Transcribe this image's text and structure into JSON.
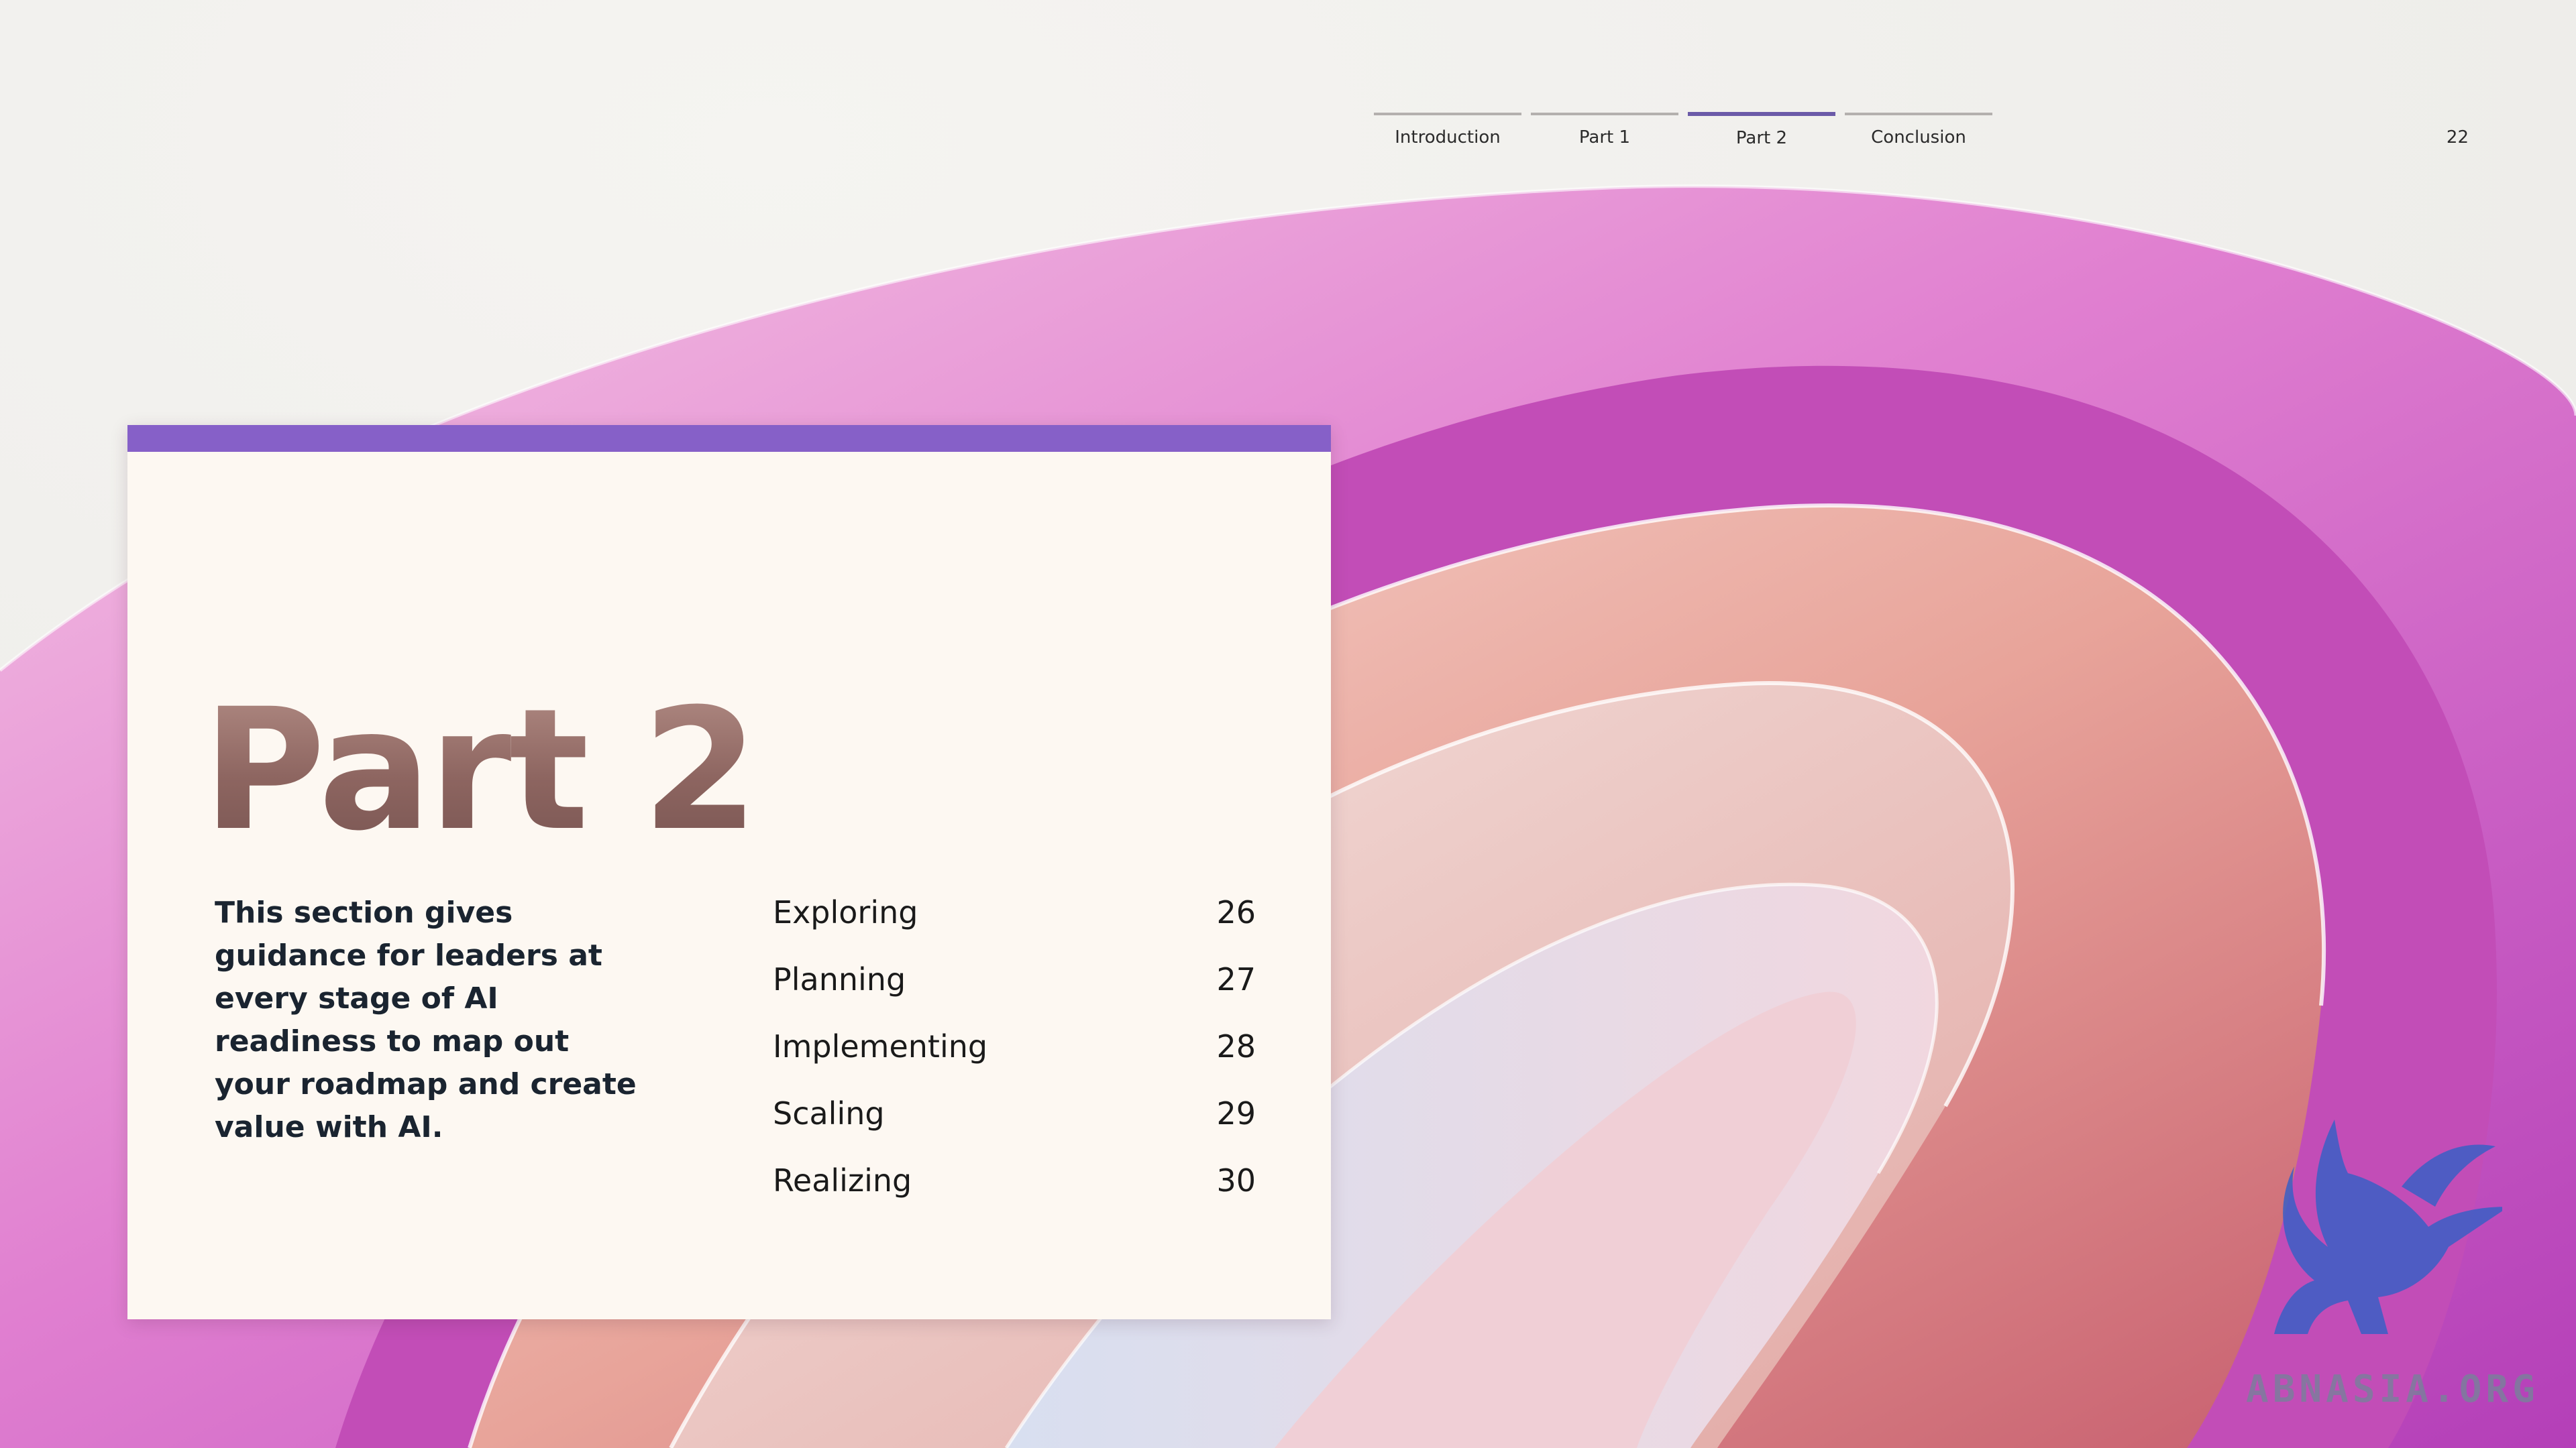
{
  "nav": {
    "items": [
      {
        "label": "Introduction"
      },
      {
        "label": "Part 1"
      },
      {
        "label": "Part 2",
        "active": true
      },
      {
        "label": "Conclusion"
      }
    ]
  },
  "page_number": "22",
  "card": {
    "title": "Part 2",
    "description": "This section gives guidance for leaders at every stage of AI readiness to map out your roadmap and create value with AI.",
    "toc": [
      {
        "label": "Exploring",
        "page": "26"
      },
      {
        "label": "Planning",
        "page": "27"
      },
      {
        "label": "Implementing",
        "page": "28"
      },
      {
        "label": "Scaling",
        "page": "29"
      },
      {
        "label": "Realizing",
        "page": "30"
      }
    ]
  },
  "watermark": {
    "text": "ABNASIA.ORG",
    "icon": "griffin-logo-icon"
  },
  "colors": {
    "accent_bar": "#8660c8",
    "nav_active": "#6b5aa8",
    "card_background": "#fdf8f2",
    "title": "#9a7068"
  }
}
